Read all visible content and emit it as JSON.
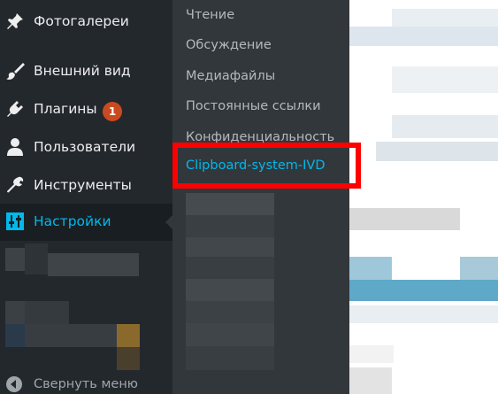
{
  "sidebar": {
    "items": [
      {
        "label": "Фотогалереи",
        "icon": "thumbtack-icon"
      },
      {
        "label": "Внешний вид",
        "icon": "paintbrush-icon"
      },
      {
        "label": "Плагины",
        "icon": "plugin-icon",
        "badge": "1"
      },
      {
        "label": "Пользователи",
        "icon": "user-icon"
      },
      {
        "label": "Инструменты",
        "icon": "wrench-icon"
      },
      {
        "label": "Настройки",
        "icon": "settings-sliders-icon",
        "current": true
      }
    ],
    "collapse_label": "Свернуть меню"
  },
  "submenu": {
    "items": [
      {
        "label": "Чтение"
      },
      {
        "label": "Обсуждение"
      },
      {
        "label": "Медиафайлы"
      },
      {
        "label": "Постоянные ссылки"
      },
      {
        "label": "Конфиденциальность"
      },
      {
        "label": "Clipboard-system-IVD",
        "active": true
      }
    ]
  },
  "colors": {
    "sidebar_bg": "#23282d",
    "submenu_bg": "#32373c",
    "accent": "#00b9eb",
    "badge": "#ca4a1f",
    "highlight_border": "#ff0000"
  }
}
